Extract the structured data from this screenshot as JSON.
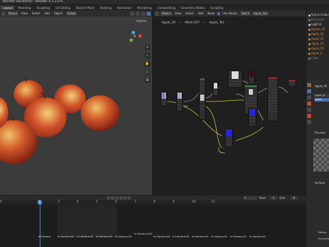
{
  "window": {
    "title": "Blender Set.blend] - Blender 4.5.3 LTS"
  },
  "workspaces": {
    "tabs": [
      "Layout",
      "Modeling",
      "Sculpting",
      "UV Editing",
      "Texture Paint",
      "Shading",
      "Animation",
      "Rendering",
      "Compositing",
      "Geometry Nodes",
      "Scripting"
    ],
    "active": "Layout"
  },
  "viewport": {
    "mode": "Object",
    "menu": [
      "View",
      "Select",
      "Add",
      "Object"
    ],
    "transform": "Global",
    "orientation_label": "Options",
    "side_buttons": [
      "+",
      "⌕",
      "✋",
      "🎥",
      "⊞"
    ]
  },
  "node_editor": {
    "mode": "Object",
    "menu": [
      "View",
      "Select",
      "Add",
      "Node"
    ],
    "use_nodes_label": "Use Nodes",
    "slot": "Slot 2",
    "material": "Apple_Tail",
    "breadcrumb": [
      "Apple_05",
      "Mesh.057",
      "Apple_Tail"
    ]
  },
  "outliner": {
    "rows": [
      {
        "label": "Scene Collect",
        "color": "#cfcfcf"
      },
      {
        "label": "Environm",
        "color": "#8a8a8a"
      },
      {
        "label": "Light Hi",
        "color": "#cfcfcf"
      },
      {
        "label": "Apples_01",
        "color": "#e0873b"
      },
      {
        "label": "Apple_02",
        "color": "#e0873b"
      },
      {
        "label": "Apple_03",
        "color": "#e0873b"
      },
      {
        "label": "Apple_04",
        "color": "#e0873b"
      },
      {
        "label": "Apple_05",
        "color": "#e0873b"
      },
      {
        "label": "Apple_0",
        "color": "#e0873b"
      },
      {
        "label": "Cube",
        "color": "#8a8a8a"
      }
    ]
  },
  "properties": {
    "object_name": "Apple_05",
    "material_slots": [
      "Apple_Sl",
      "Apple_"
    ],
    "section_preview": "Preview",
    "section_surface": "Surface",
    "labels": [
      "Diffuse",
      "Subsurfa"
    ]
  },
  "timeline": {
    "start_label": "Start",
    "start_value": "1",
    "end_label": "End",
    "end_value": "8",
    "current_frame": "1",
    "ruler_ticks": [
      "0",
      "1",
      "2",
      "3",
      "4",
      "5",
      "6",
      "7",
      "8",
      "9",
      "10",
      "11"
    ],
    "markers": [
      "Camera",
      "Camera.00",
      "Camera.00",
      "Camera.00",
      "Camera.00",
      "Camera.005",
      "Camera.00",
      "Camera.00",
      "Camera.00",
      "Camera.01",
      "Camera.01",
      "Camera.01"
    ]
  },
  "colors": {
    "accent": "#4772b3",
    "playhead": "#4c87d0",
    "apple_red": "#c8381e",
    "apple_yellow": "#d9a44a"
  }
}
